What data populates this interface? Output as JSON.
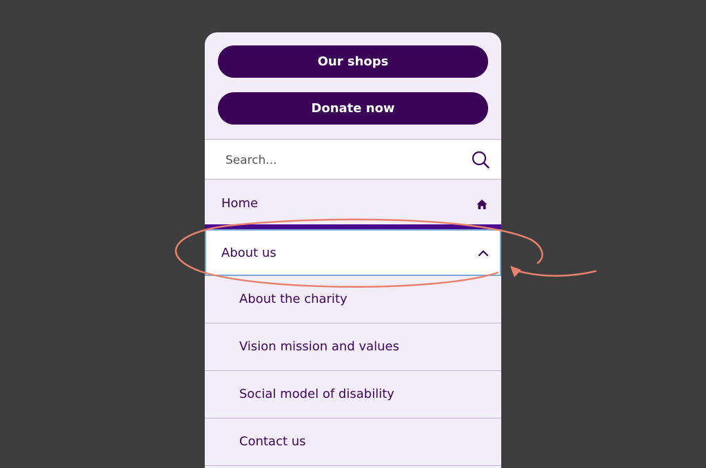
{
  "buttons": {
    "shops_label": "Our shops",
    "donate_label": "Donate now"
  },
  "search": {
    "placeholder": "Search..."
  },
  "nav": {
    "home": {
      "label": "Home",
      "icon": "home-icon"
    },
    "about": {
      "label": "About us",
      "icon": "chevron-up-icon",
      "expanded": true,
      "children": [
        {
          "label": "About the charity"
        },
        {
          "label": "Vision mission and values"
        },
        {
          "label": "Social model of disability"
        },
        {
          "label": "Contact us"
        }
      ]
    }
  },
  "colors": {
    "page_background": "#3d3d3d",
    "panel_background": "#f2edf8",
    "brand_purple": "#3b0358",
    "active_bar": "#4a0a8f",
    "focus_outline": "#7aa6d4",
    "annotation": "#e8826c"
  }
}
